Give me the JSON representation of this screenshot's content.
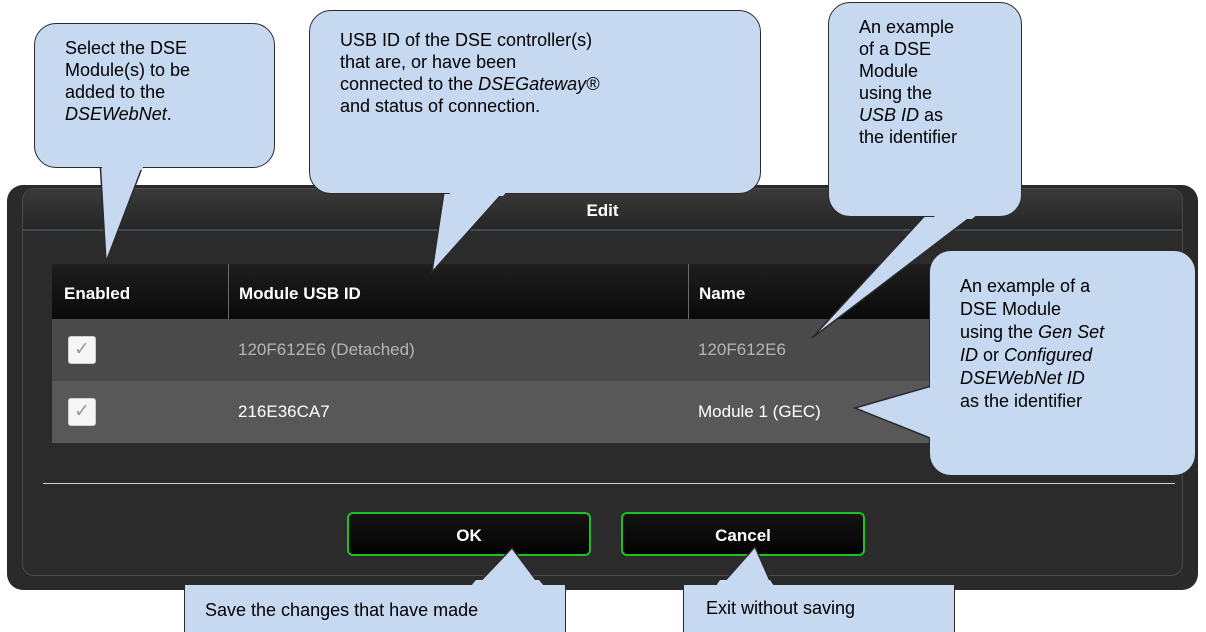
{
  "dialog": {
    "title": "Edit",
    "columns": [
      "Enabled",
      "Module USB ID",
      "Name"
    ],
    "rows": [
      {
        "enabled": true,
        "usb_id": "120F612E6 (Detached)",
        "name": "120F612E6"
      },
      {
        "enabled": true,
        "usb_id": "216E36CA7",
        "name": "Module 1 (GEC)"
      }
    ],
    "ok_label": "OK",
    "cancel_label": "Cancel",
    "check_glyph": "✓"
  },
  "callouts": {
    "select": {
      "l1": "Select the DSE",
      "l2": "Module(s) to be",
      "l3": "added to the",
      "l4": "DSEWebNet",
      "l4_suffix": "."
    },
    "usb": {
      "l1": "USB ID of the DSE controller(s)",
      "l2": "that are, or have been",
      "l3": "connected to the ",
      "l3_em": "DSEGateway®",
      "l4": "and status of connection."
    },
    "example_usb": {
      "l1": "An example",
      "l2": "of a DSE",
      "l3": "Module",
      "l4": "using the",
      "l5_em": "USB ID",
      "l5": " as",
      "l6": "the identifier"
    },
    "example_gen": {
      "l1": "An example of a",
      "l2": "DSE Module",
      "l3": "using the ",
      "l3_em": "Gen Set",
      "l4_em": "ID",
      "l4": " or ",
      "l4_em2": "Configured",
      "l5_em": "DSEWebNet ID",
      "l6": "as the identifier"
    },
    "save": "Save the changes that have made",
    "exit": "Exit without saving"
  },
  "colors": {
    "callout_fill": "#c6d9f1",
    "button_border": "#1fc01f",
    "dialog_bg": "#2a2a2a"
  }
}
